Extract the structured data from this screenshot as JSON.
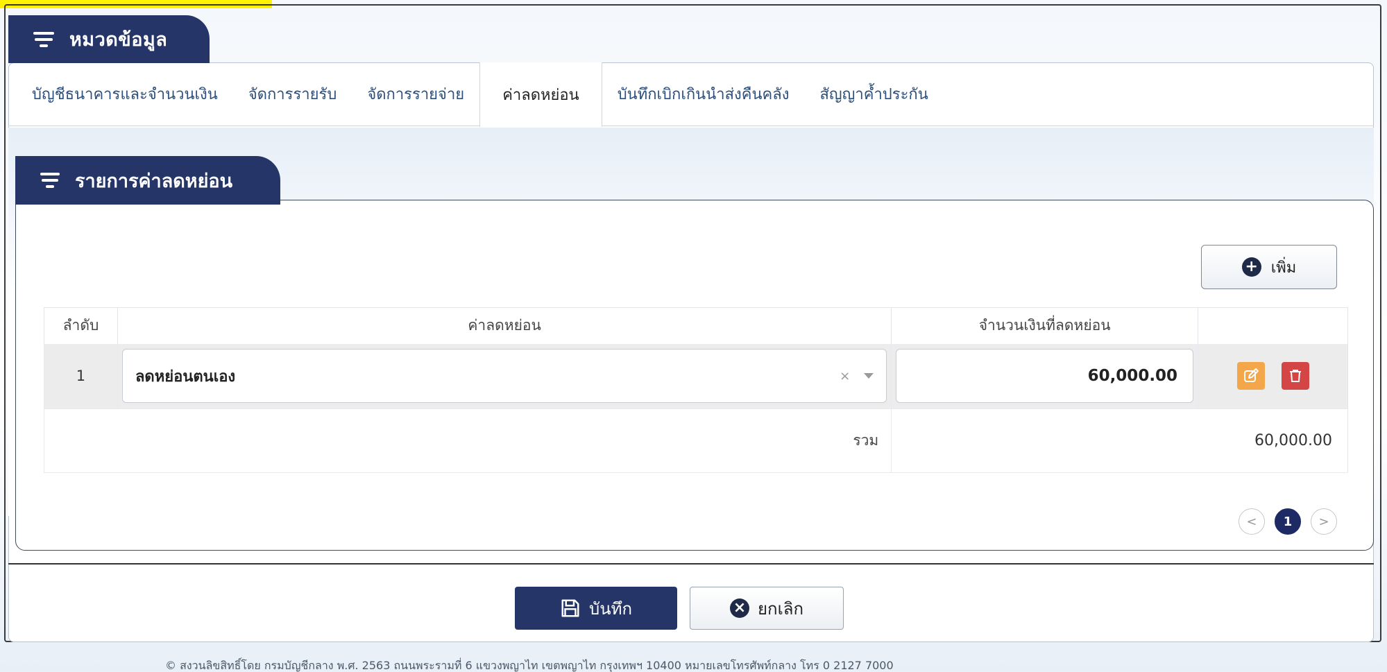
{
  "section": {
    "title": "หมวดข้อมูล"
  },
  "tabs": [
    {
      "label": "บัญชีธนาคารและจำนวนเงิน"
    },
    {
      "label": "จัดการรายรับ"
    },
    {
      "label": "จัดการรายจ่าย"
    },
    {
      "label": "ค่าลดหย่อน",
      "active": true
    },
    {
      "label": "บันทึกเบิกเกินนำส่งคืนคลัง"
    },
    {
      "label": "สัญญาค้ำประกัน"
    }
  ],
  "subsection": {
    "title": "รายการค่าลดหย่อน"
  },
  "add_button": {
    "label": "เพิ่ม"
  },
  "table": {
    "headers": [
      "ลำดับ",
      "ค่าลดหย่อน",
      "จำนวนเงินที่ลดหย่อน",
      ""
    ],
    "rows": [
      {
        "no": "1",
        "item": "ลดหย่อนตนเอง",
        "amount": "60,000.00"
      }
    ],
    "sum_label": "รวม",
    "sum_value": "60,000.00"
  },
  "pagination": {
    "prev": "<",
    "current": "1",
    "next": ">"
  },
  "footer": {
    "save_label": "บันทึก",
    "cancel_label": "ยกเลิก",
    "copyright": "© สงวนลิขสิทธิ์โดย กรมบัญชีกลาง พ.ศ. 2563 ถนนพระรามที่ 6 แขวงพญาไท เขตพญาไท กรุงเทพฯ 10400 หมายเลขโทรศัพท์กลาง โทร 0 2127 7000"
  },
  "colors": {
    "navy": "#253567",
    "edit": "#f3a74a",
    "delete": "#d44545",
    "highlight": "#fff200"
  }
}
